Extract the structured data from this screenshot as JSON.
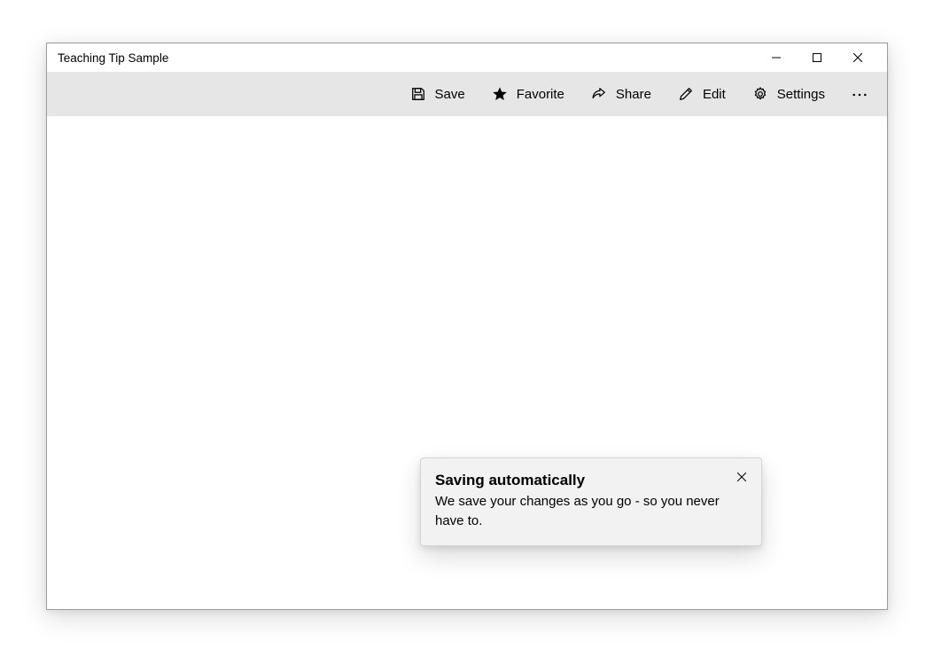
{
  "window": {
    "title": "Teaching Tip Sample"
  },
  "commandbar": {
    "save": "Save",
    "favorite": "Favorite",
    "share": "Share",
    "edit": "Edit",
    "settings": "Settings"
  },
  "teaching_tip": {
    "title": "Saving automatically",
    "subtitle": "We save your changes as you go - so you never have to."
  }
}
